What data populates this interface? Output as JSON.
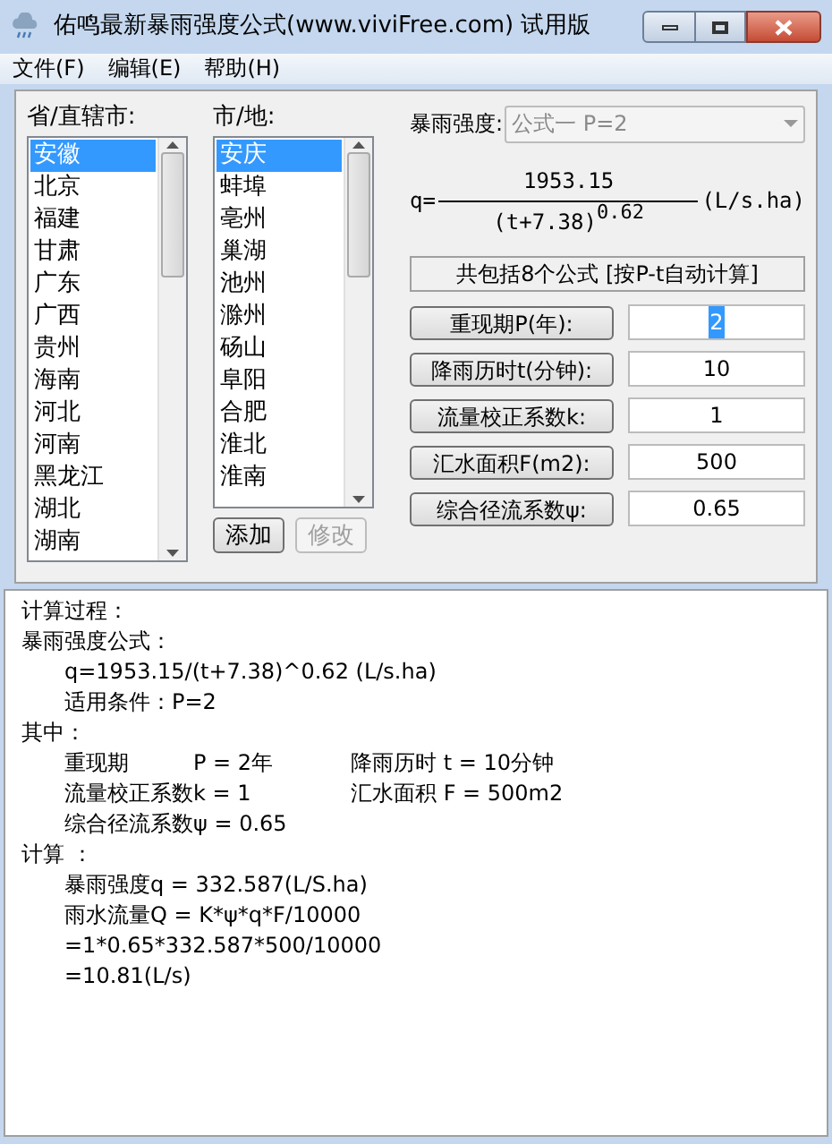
{
  "window": {
    "title": "佑鸣最新暴雨强度公式(www.viviFree.com) 试用版"
  },
  "menu": [
    "文件(F)",
    "编辑(E)",
    "帮助(H)"
  ],
  "province_list": {
    "label": "省/直辖市:",
    "items": [
      {
        "text": "安徽",
        "selected": true
      },
      {
        "text": "北京",
        "selected": false
      },
      {
        "text": "福建",
        "selected": false
      },
      {
        "text": "甘肃",
        "selected": false
      },
      {
        "text": "广东",
        "selected": false
      },
      {
        "text": "广西",
        "selected": false
      },
      {
        "text": "贵州",
        "selected": false
      },
      {
        "text": "海南",
        "selected": false
      },
      {
        "text": "河北",
        "selected": false
      },
      {
        "text": "河南",
        "selected": false
      },
      {
        "text": "黑龙江",
        "selected": false
      },
      {
        "text": "湖北",
        "selected": false
      },
      {
        "text": "湖南",
        "selected": false
      }
    ]
  },
  "city_list": {
    "label": "市/地:",
    "items": [
      {
        "text": "安庆",
        "selected": true
      },
      {
        "text": "蚌埠",
        "selected": false
      },
      {
        "text": "亳州",
        "selected": false
      },
      {
        "text": "巢湖",
        "selected": false
      },
      {
        "text": "池州",
        "selected": false
      },
      {
        "text": "滁州",
        "selected": false
      },
      {
        "text": "砀山",
        "selected": false
      },
      {
        "text": "阜阳",
        "selected": false
      },
      {
        "text": "合肥",
        "selected": false
      },
      {
        "text": "淮北",
        "selected": false
      },
      {
        "text": "淮南",
        "selected": false
      }
    ]
  },
  "list_buttons": [
    {
      "label": "添加",
      "disabled": false
    },
    {
      "label": "修改",
      "disabled": true
    }
  ],
  "formula_select": {
    "label": "暴雨强度:",
    "value": "公式一 P=2",
    "disabled": true
  },
  "formula": {
    "prefix": "q=",
    "numerator": "1953.15",
    "denominator": "(t+7.38)",
    "exponent": "0.62",
    "unit": "(L/s.ha)"
  },
  "info_box": "共包括8个公式 [按P-t自动计算]",
  "params": [
    {
      "button": "重现期P(年):",
      "value": "2",
      "text_selected": true
    },
    {
      "button": "降雨历时t(分钟):",
      "value": "10",
      "text_selected": false
    },
    {
      "button": "流量校正系数k:",
      "value": "1",
      "text_selected": false
    },
    {
      "button": "汇水面积F(m2):",
      "value": "500",
      "text_selected": false
    },
    {
      "button": "综合径流系数ψ:",
      "value": "0.65",
      "text_selected": false
    }
  ],
  "result": [
    {
      "heading": "计算过程："
    },
    {
      "heading": "暴雨强度公式：",
      "lines": [
        {
          "cells": [
            "q=1953.15/(t+7.38)^0.62 (L/s.ha)"
          ]
        },
        {
          "cells": [
            "适用条件：P=2"
          ]
        }
      ]
    },
    {
      "heading": "其中：",
      "lines": [
        {
          "cells": [
            "重现期",
            "P = 2年",
            "降雨历时 t = 10分钟"
          ]
        },
        {
          "cells": [
            "流量校正系数k = 1",
            "汇水面积 F = 500m2"
          ]
        },
        {
          "cells": [
            "综合径流系数ψ = 0.65"
          ]
        }
      ]
    },
    {
      "heading": "计算 ：",
      "lines": [
        {
          "cells": [
            "暴雨强度q = 332.587(L/S.ha)"
          ]
        },
        {
          "cells": [
            "雨水流量Q = K*ψ*q*F/10000"
          ]
        },
        {
          "cells": [
            "=1*0.65*332.587*500/10000"
          ]
        },
        {
          "cells": [
            "=10.81(L/s)"
          ]
        }
      ]
    }
  ]
}
